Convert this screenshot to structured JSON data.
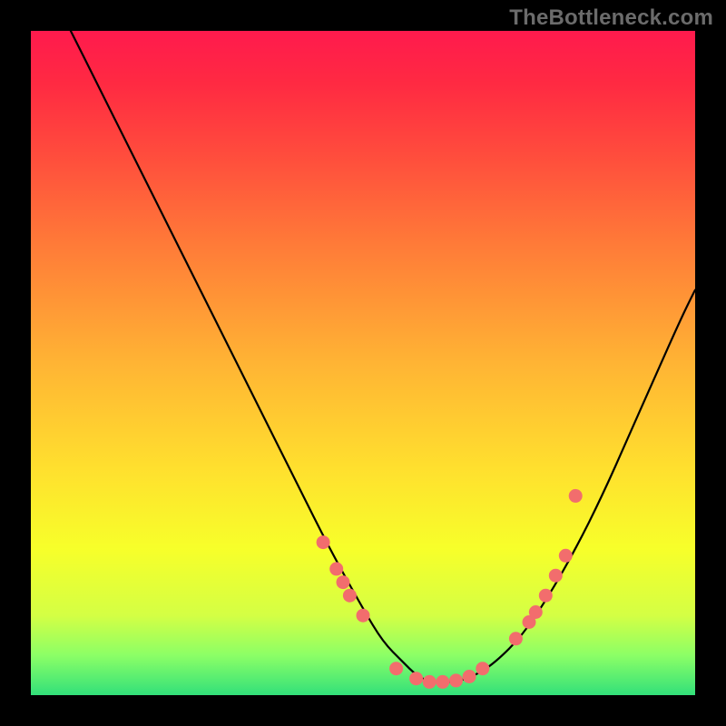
{
  "watermark": "TheBottleneck.com",
  "colors": {
    "frame": "#000000",
    "curve_stroke": "#000000",
    "point_fill": "#f26d6d",
    "point_stroke": "#f26d6d",
    "watermark_text": "#6b6b6b"
  },
  "chart_data": {
    "type": "line",
    "title": "",
    "xlabel": "",
    "ylabel": "",
    "xlim": [
      0,
      100
    ],
    "ylim": [
      0,
      100
    ],
    "grid": false,
    "curve": {
      "name": "bottleneck-curve",
      "x": [
        6,
        10,
        15,
        20,
        25,
        30,
        35,
        40,
        45,
        50,
        53,
        56,
        58,
        60,
        62,
        64,
        67,
        70,
        74,
        78,
        82,
        86,
        90,
        94,
        98,
        100
      ],
      "y": [
        100,
        92,
        82,
        72,
        62,
        52,
        42,
        32,
        22,
        13,
        8,
        5,
        3,
        2,
        2,
        2,
        3,
        5,
        9,
        15,
        22,
        30,
        39,
        48,
        57,
        61
      ]
    },
    "series": [
      {
        "name": "left-cluster",
        "x": [
          44,
          46,
          47,
          48,
          50
        ],
        "y": [
          23,
          19,
          17,
          15,
          12
        ]
      },
      {
        "name": "valley-cluster",
        "x": [
          55,
          58,
          60,
          62,
          64,
          66,
          68
        ],
        "y": [
          4,
          2.5,
          2,
          2,
          2.2,
          2.8,
          4
        ]
      },
      {
        "name": "right-cluster",
        "x": [
          73,
          75,
          76,
          77.5,
          79,
          80.5
        ],
        "y": [
          8.5,
          11,
          12.5,
          15,
          18,
          21
        ]
      },
      {
        "name": "right-outlier",
        "x": [
          82
        ],
        "y": [
          30
        ]
      }
    ]
  }
}
